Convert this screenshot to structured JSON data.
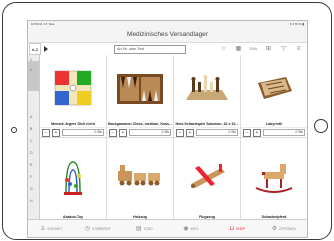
{
  "status": {
    "time": "10:53  Di. 17. Nov.",
    "battery": "▾ 4 76 % ▮"
  },
  "header": {
    "title": "Medizinisches Versandlager"
  },
  "toolbar": {
    "az_label": "A-Z",
    "search_placeholder": "Art.Nr. oder Text",
    "icons": [
      "star-icon",
      "calendar-icon",
      "ean-icon",
      "barcode-icon",
      "filter-icon",
      "menu-icon"
    ],
    "ean_label": "EAN"
  },
  "sidebar": {
    "labels": [
      "1",
      "2",
      "A",
      "B",
      "C",
      "D",
      "E",
      "F",
      "G",
      "H"
    ]
  },
  "products": [
    {
      "name": "Mensch ärgere Dich nicht",
      "qty": "0 Stk"
    },
    {
      "name": "Backgammon Chios, medium, Kass...",
      "qty": "0 Stk"
    },
    {
      "name": "Holz-Schachspiel Salomon, 32 x 32...",
      "qty": "0 Stk"
    },
    {
      "name": "Labyrinth",
      "qty": "0 Stk"
    },
    {
      "name": "Abakus-Toy",
      "qty": ""
    },
    {
      "name": "Holzzug",
      "qty": ""
    },
    {
      "name": "Flugzeug",
      "qty": ""
    },
    {
      "name": "Schaukelpferd",
      "qty": ""
    }
  ],
  "tabs": [
    {
      "label": "KONTAKT",
      "icon": "person-icon"
    },
    {
      "label": "VORBEREIT",
      "icon": "clock-icon"
    },
    {
      "label": "TODO",
      "icon": "doc-icon"
    },
    {
      "label": "INFO",
      "icon": "eye-icon"
    },
    {
      "label": "SHOP",
      "icon": "cart-icon"
    },
    {
      "label": "OPTIONEN",
      "icon": "gear-icon"
    }
  ],
  "colors": {
    "accent": "#e22233"
  }
}
